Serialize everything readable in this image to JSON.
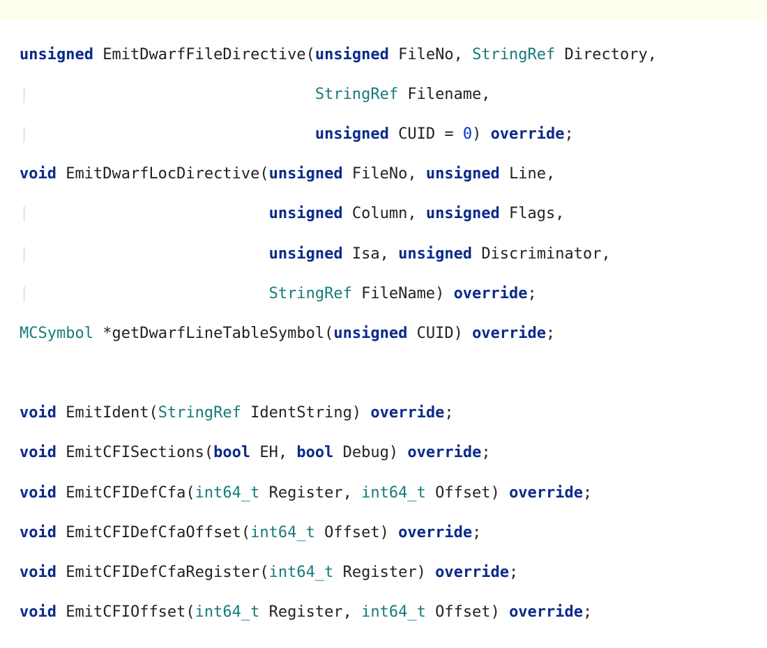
{
  "tokens": {
    "kw_unsigned": "unsigned",
    "kw_void": "void",
    "kw_bool": "bool",
    "kw_override": "override",
    "ty_StringRef": "StringRef",
    "ty_MCSymbol": "MCSymbol",
    "ty_int64": "int64_t",
    "num_zero": "0",
    "guide_pipe": "|"
  },
  "sig1": {
    "fn": "EmitDwarfFileDirective",
    "p1": "FileNo",
    "p2": "Directory",
    "p3": "Filename",
    "p4": "CUID"
  },
  "sig2": {
    "fn": "EmitDwarfLocDirective",
    "p1": "FileNo",
    "p2": "Line",
    "p3": "Column",
    "p4": "Flags",
    "p5": "Isa",
    "p6": "Discriminator",
    "p7": "FileName"
  },
  "sig3": {
    "fn": "getDwarfLineTableSymbol",
    "p1": "CUID",
    "star": "*"
  },
  "sig4": {
    "fn": "EmitIdent",
    "p1": "IdentString"
  },
  "sig5": {
    "fn": "EmitCFISections",
    "p1": "EH",
    "p2": "Debug"
  },
  "sig6": {
    "fn": "EmitCFIDefCfa",
    "p1": "Register",
    "p2": "Offset"
  },
  "sig7": {
    "fn": "EmitCFIDefCfaOffset",
    "p1": "Offset"
  },
  "sig8": {
    "fn": "EmitCFIDefCfaRegister",
    "p1": "Register"
  },
  "sig9": {
    "fn": "EmitCFIOffset",
    "p1": "Register",
    "p2": "Offset"
  }
}
